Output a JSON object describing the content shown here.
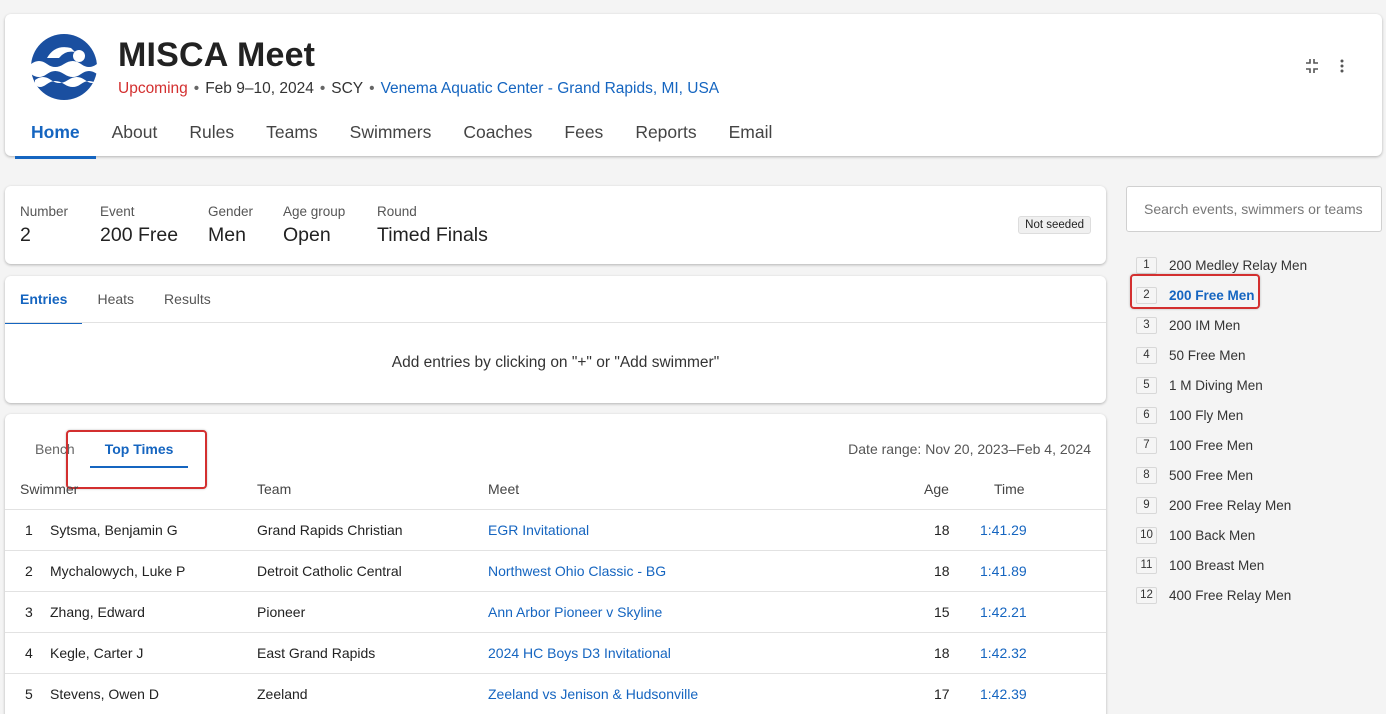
{
  "meet": {
    "title": "MISCA Meet",
    "status": "Upcoming",
    "dates": "Feb 9–10, 2024",
    "course": "SCY",
    "venue": "Venema Aquatic Center - Grand Rapids, MI, USA",
    "logo_icon": "swimmer-logo-icon"
  },
  "header_actions": {
    "collapse_icon": "collapse-icon",
    "more_icon": "more-vert-icon"
  },
  "nav": {
    "items": [
      "Home",
      "About",
      "Rules",
      "Teams",
      "Swimmers",
      "Coaches",
      "Fees",
      "Reports",
      "Email"
    ],
    "active": "Home"
  },
  "event_info": {
    "number_label": "Number",
    "number": "2",
    "event_label": "Event",
    "event": "200 Free",
    "gender_label": "Gender",
    "gender": "Men",
    "age_label": "Age group",
    "age": "Open",
    "round_label": "Round",
    "round": "Timed Finals",
    "seed_badge": "Not seeded"
  },
  "entries": {
    "tabs": [
      "Entries",
      "Heats",
      "Results"
    ],
    "active_tab": "Entries",
    "message": "Add entries by clicking on \"+\" or \"Add swimmer\""
  },
  "top_times": {
    "tabs": [
      "Bench",
      "Top Times"
    ],
    "active_tab": "Top Times",
    "date_range": "Date range: Nov 20, 2023–Feb 4, 2024",
    "columns": {
      "swimmer": "Swimmer",
      "team": "Team",
      "meet": "Meet",
      "age": "Age",
      "time": "Time"
    },
    "rows": [
      {
        "rank": "1",
        "swimmer": "Sytsma, Benjamin G",
        "team": "Grand Rapids Christian",
        "meet": "EGR Invitational",
        "age": "18",
        "time": "1:41.29"
      },
      {
        "rank": "2",
        "swimmer": "Mychalowych, Luke P",
        "team": "Detroit Catholic Central",
        "meet": "Northwest Ohio Classic - BG",
        "age": "18",
        "time": "1:41.89"
      },
      {
        "rank": "3",
        "swimmer": "Zhang, Edward",
        "team": "Pioneer",
        "meet": "Ann Arbor Pioneer v Skyline",
        "age": "15",
        "time": "1:42.21"
      },
      {
        "rank": "4",
        "swimmer": "Kegle, Carter J",
        "team": "East Grand Rapids",
        "meet": "2024 HC Boys D3 Invitational",
        "age": "18",
        "time": "1:42.32"
      },
      {
        "rank": "5",
        "swimmer": "Stevens, Owen D",
        "team": "Zeeland",
        "meet": "Zeeland vs Jenison & Hudsonville",
        "age": "17",
        "time": "1:42.39"
      }
    ]
  },
  "sidebar": {
    "search_placeholder": "Search events, swimmers or teams",
    "events": [
      {
        "num": "1",
        "name": "200 Medley Relay Men"
      },
      {
        "num": "2",
        "name": "200 Free Men",
        "active": true
      },
      {
        "num": "3",
        "name": "200 IM Men"
      },
      {
        "num": "4",
        "name": "50 Free Men"
      },
      {
        "num": "5",
        "name": "1 M Diving Men"
      },
      {
        "num": "6",
        "name": "100 Fly Men"
      },
      {
        "num": "7",
        "name": "100 Free Men"
      },
      {
        "num": "8",
        "name": "500 Free Men"
      },
      {
        "num": "9",
        "name": "200 Free Relay Men"
      },
      {
        "num": "10",
        "name": "100 Back Men"
      },
      {
        "num": "11",
        "name": "100 Breast Men"
      },
      {
        "num": "12",
        "name": "400 Free Relay Men"
      }
    ]
  },
  "colors": {
    "accent": "#1565c0",
    "status": "#d32f2f",
    "highlight": "#d32f2f"
  }
}
